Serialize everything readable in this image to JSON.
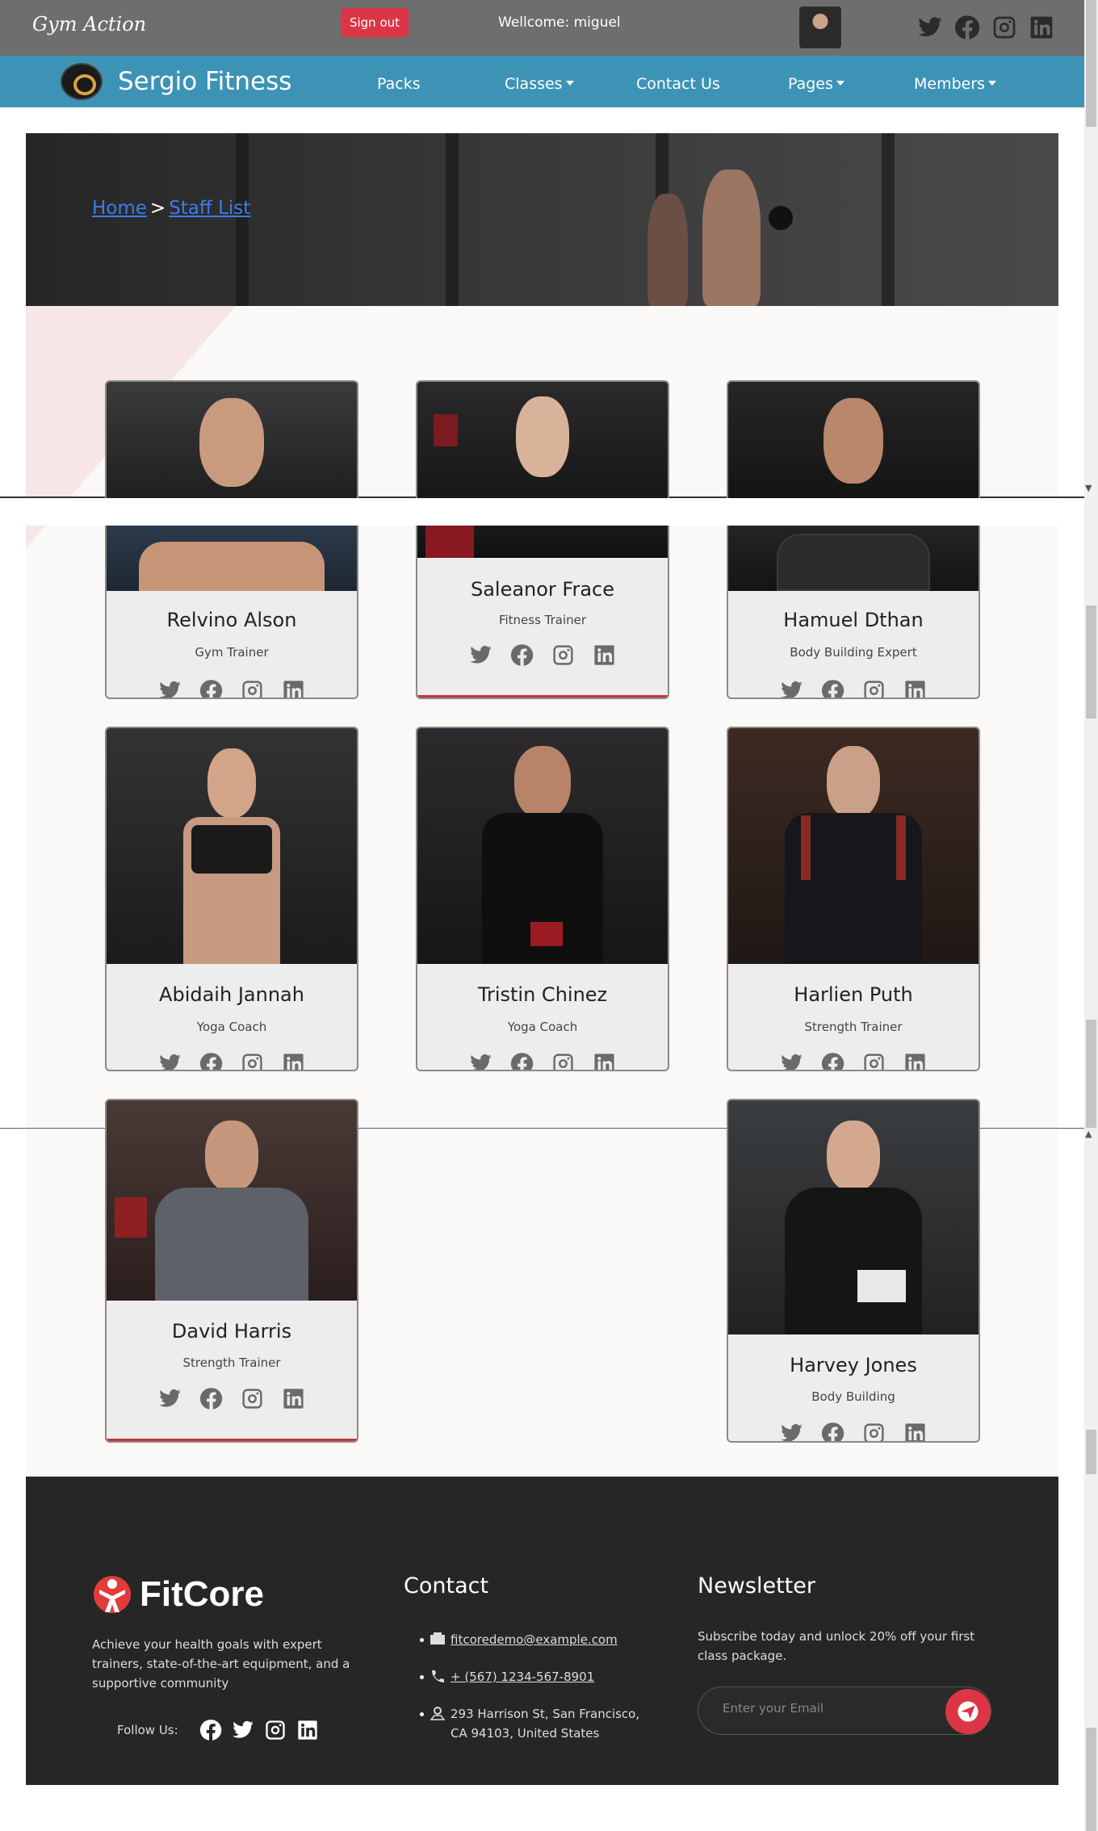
{
  "topbar": {
    "brand": "Gym Action",
    "signout_label": "Sign out",
    "welcome": "Wellcome: miguel"
  },
  "navbar": {
    "brand": "Sergio Fitness",
    "items": [
      {
        "label": "Packs",
        "dropdown": false
      },
      {
        "label": "Classes",
        "dropdown": true
      },
      {
        "label": "Contact Us",
        "dropdown": false
      },
      {
        "label": "Pages",
        "dropdown": true
      },
      {
        "label": "Members",
        "dropdown": true
      }
    ]
  },
  "breadcrumb": {
    "home": "Home",
    "separator": ">",
    "current": "Staff List"
  },
  "staff": [
    {
      "name": "Relvino Alson",
      "role": "Gym Trainer"
    },
    {
      "name": "Saleanor Frace",
      "role": "Fitness Trainer"
    },
    {
      "name": "Hamuel Dthan",
      "role": "Body Building Expert"
    },
    {
      "name": "Abidaih Jannah",
      "role": "Yoga Coach"
    },
    {
      "name": "Tristin Chinez",
      "role": "Yoga Coach"
    },
    {
      "name": "Harlien Puth",
      "role": "Strength Trainer"
    },
    {
      "name": "David Harris",
      "role": "Strength Trainer"
    },
    {
      "name": "Harvey Jones",
      "role": "Body Building"
    }
  ],
  "footer": {
    "brand": "FitCore",
    "description": "Achieve your health goals with expert trainers, state-of-the-art equipment, and a supportive community",
    "follow_label": "Follow Us:",
    "contact_heading": "Contact",
    "email": "fitcoredemo@example.com",
    "phone": "+ (567) 1234-567-8901",
    "address": "293 Harrison St, San Francisco, CA 94103, United States",
    "newsletter_heading": "Newsletter",
    "newsletter_text": "Subscribe today and unlock 20% off your first class package.",
    "email_placeholder": "Enter your Email"
  },
  "icons": {
    "social": [
      "twitter-icon",
      "facebook-icon",
      "instagram-icon",
      "linkedin-icon"
    ]
  },
  "colors": {
    "topbar": "#6e6e6e",
    "navbar": "#3d93b6",
    "signout": "#dc3545",
    "footer": "#262626",
    "accent": "#c8313e",
    "link": "#3d7bf2"
  }
}
